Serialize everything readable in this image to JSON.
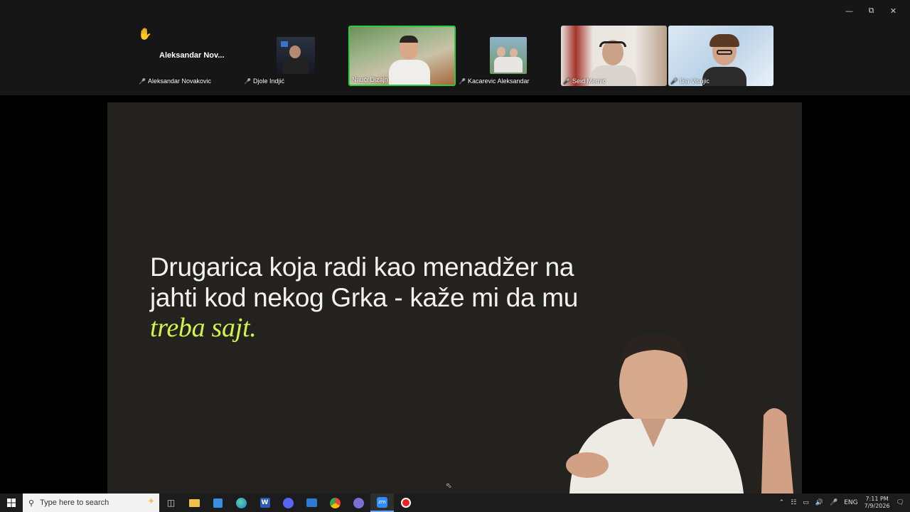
{
  "window": {
    "minimize_icon": "minimize-icon",
    "restore_icon": "restore-icon",
    "close_icon": "close-icon"
  },
  "participants": {
    "raised_hand_icon": "raised-hand-icon",
    "featured_name": "Aleksandar  Nov...",
    "tiles": [
      {
        "name": "Aleksandar Novakovic",
        "muted": true
      },
      {
        "name": "Djole Indjić",
        "muted": true
      },
      {
        "name": "Nauči Dizajn",
        "muted": false,
        "speaking": true
      },
      {
        "name": "Kacarevic Aleksandar",
        "muted": true
      },
      {
        "name": "Seid Memić",
        "muted": true
      },
      {
        "name": "Ilija Visnjic",
        "muted": true
      }
    ]
  },
  "slide": {
    "line1": "Drugarica koja radi kao menadžer na",
    "line2": "jahti kod nekog Grka - kaže mi da mu",
    "accent": "treba sajt.",
    "accent_color": "#d7f04a",
    "background": "#23221f"
  },
  "taskbar": {
    "search_placeholder": "Type here to search",
    "apps": [
      "task-view-icon",
      "file-explorer-icon",
      "store-icon",
      "edge-icon",
      "word-icon",
      "discord-icon",
      "mail-icon",
      "chrome-icon",
      "app-icon",
      "zoom-icon",
      "record-icon"
    ],
    "active_app": "zoom-icon",
    "language": "ENG",
    "time": "7:11 PM",
    "date": "7/9/2026"
  }
}
